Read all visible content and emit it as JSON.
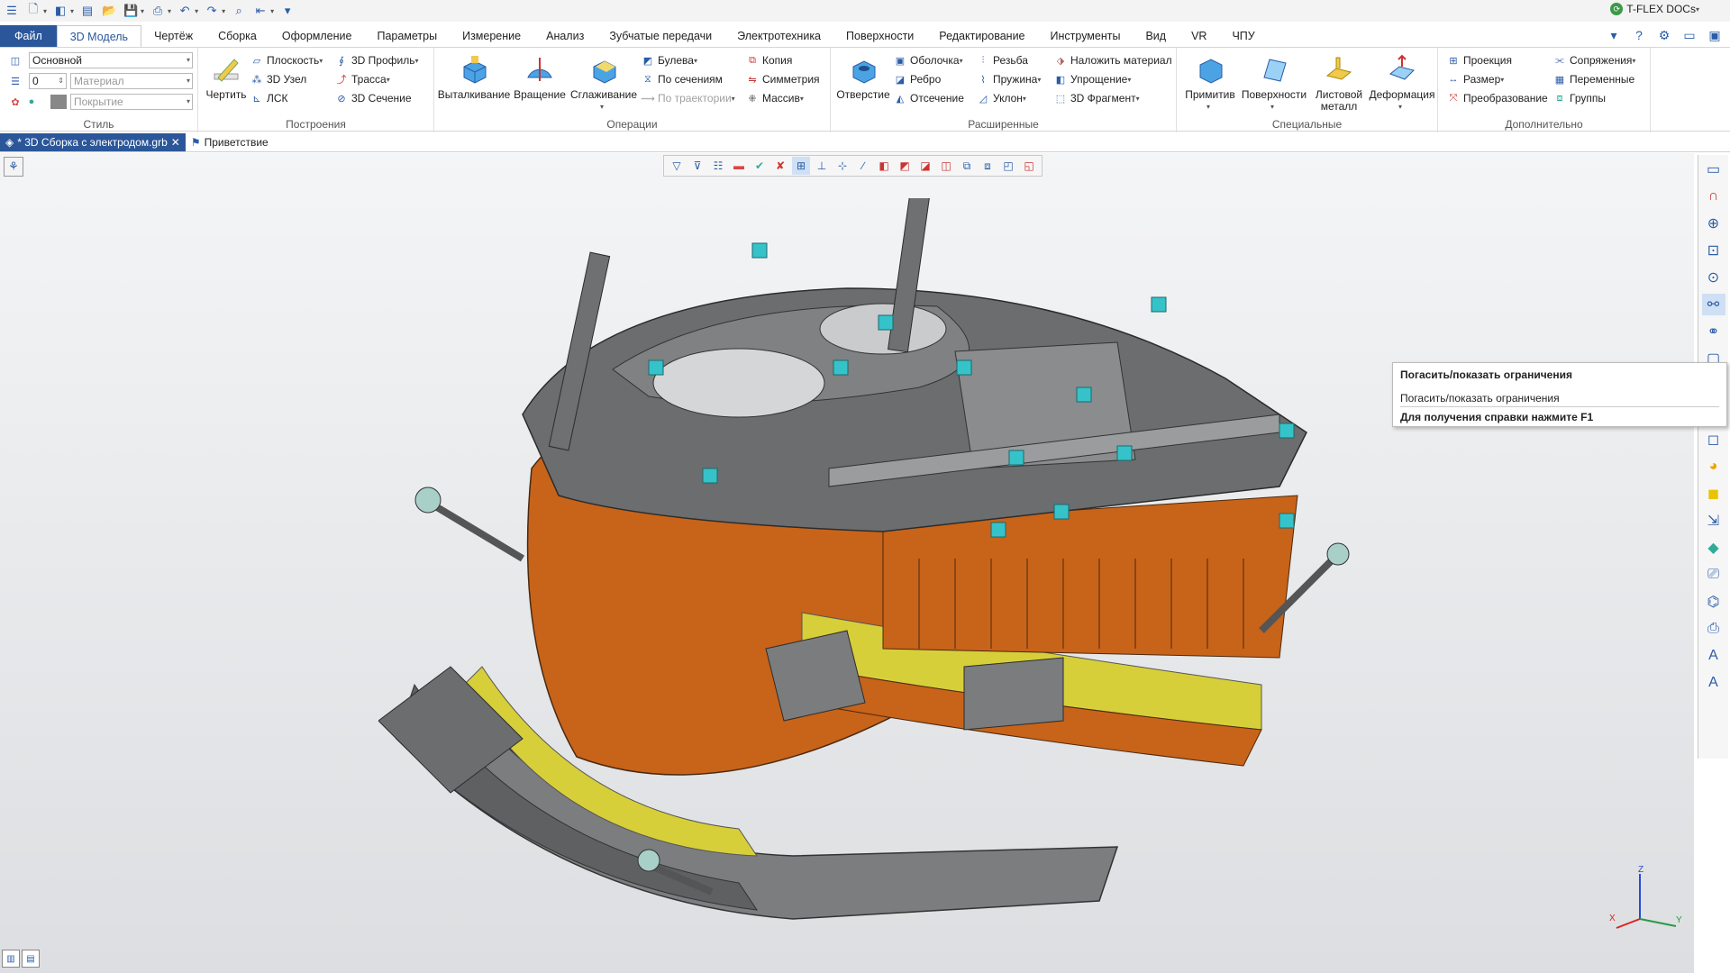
{
  "app": {
    "brand": "T-FLEX DOCs"
  },
  "menu_tabs": [
    "Файл",
    "3D Модель",
    "Чертёж",
    "Сборка",
    "Оформление",
    "Параметры",
    "Измерение",
    "Анализ",
    "Зубчатые передачи",
    "Электротехника",
    "Поверхности",
    "Редактирование",
    "Инструменты",
    "Вид",
    "VR",
    "ЧПУ"
  ],
  "active_tab": "3D Модель",
  "ribbon": {
    "style": {
      "label": "Стиль",
      "layer": "Основной",
      "level": "0",
      "material": "Материал",
      "coating": "Покрытие"
    },
    "build": {
      "label": "Построения",
      "draw": "Чертить",
      "plane": "Плоскость",
      "node3d": "3D Узел",
      "lsk": "ЛСК",
      "profile3d": "3D Профиль",
      "path": "Трасса",
      "section3d": "3D Сечение"
    },
    "ops": {
      "label": "Операции",
      "extrude": "Выталкивание",
      "rotate": "Вращение",
      "smooth": "Сглаживание",
      "boolean": "Булева",
      "by_sections": "По сечениям",
      "by_path": "По траектории",
      "copy": "Копия",
      "symmetry": "Симметрия",
      "array": "Массив"
    },
    "ext": {
      "label": "Расширенные",
      "hole": "Отверстие",
      "shell": "Оболочка",
      "rib": "Ребро",
      "cut": "Отсечение",
      "thread": "Резьба",
      "spring": "Пружина",
      "slope": "Уклон",
      "apply_material": "Наложить материал",
      "simplify": "Упрощение",
      "fragment3d": "3D Фрагмент"
    },
    "special": {
      "label": "Специальные",
      "primitives": "Примитив",
      "surfaces": "Поверхности",
      "sheet_metal": "Листовой металл",
      "deform": "Деформация"
    },
    "extra": {
      "label": "Дополнительно",
      "projection": "Проекция",
      "size": "Размер",
      "transform": "Преобразование",
      "mates": "Сопряжения",
      "variables": "Переменные",
      "groups": "Группы"
    }
  },
  "doc_tabs": {
    "active": "* 3D Сборка с электродом.grb",
    "other": "Приветствие"
  },
  "tooltip": {
    "title": "Погасить/показать ограничения",
    "desc": "Погасить/показать ограничения",
    "help": "Для получения справки нажмите F1"
  },
  "axes": {
    "x": "X",
    "y": "Y",
    "z": "Z"
  },
  "colors": {
    "accent": "#2b579a",
    "copper": "#c8631a",
    "steel": "#6b6d6e",
    "yellow": "#d7cf3a",
    "cyan": "#35c3c9"
  }
}
